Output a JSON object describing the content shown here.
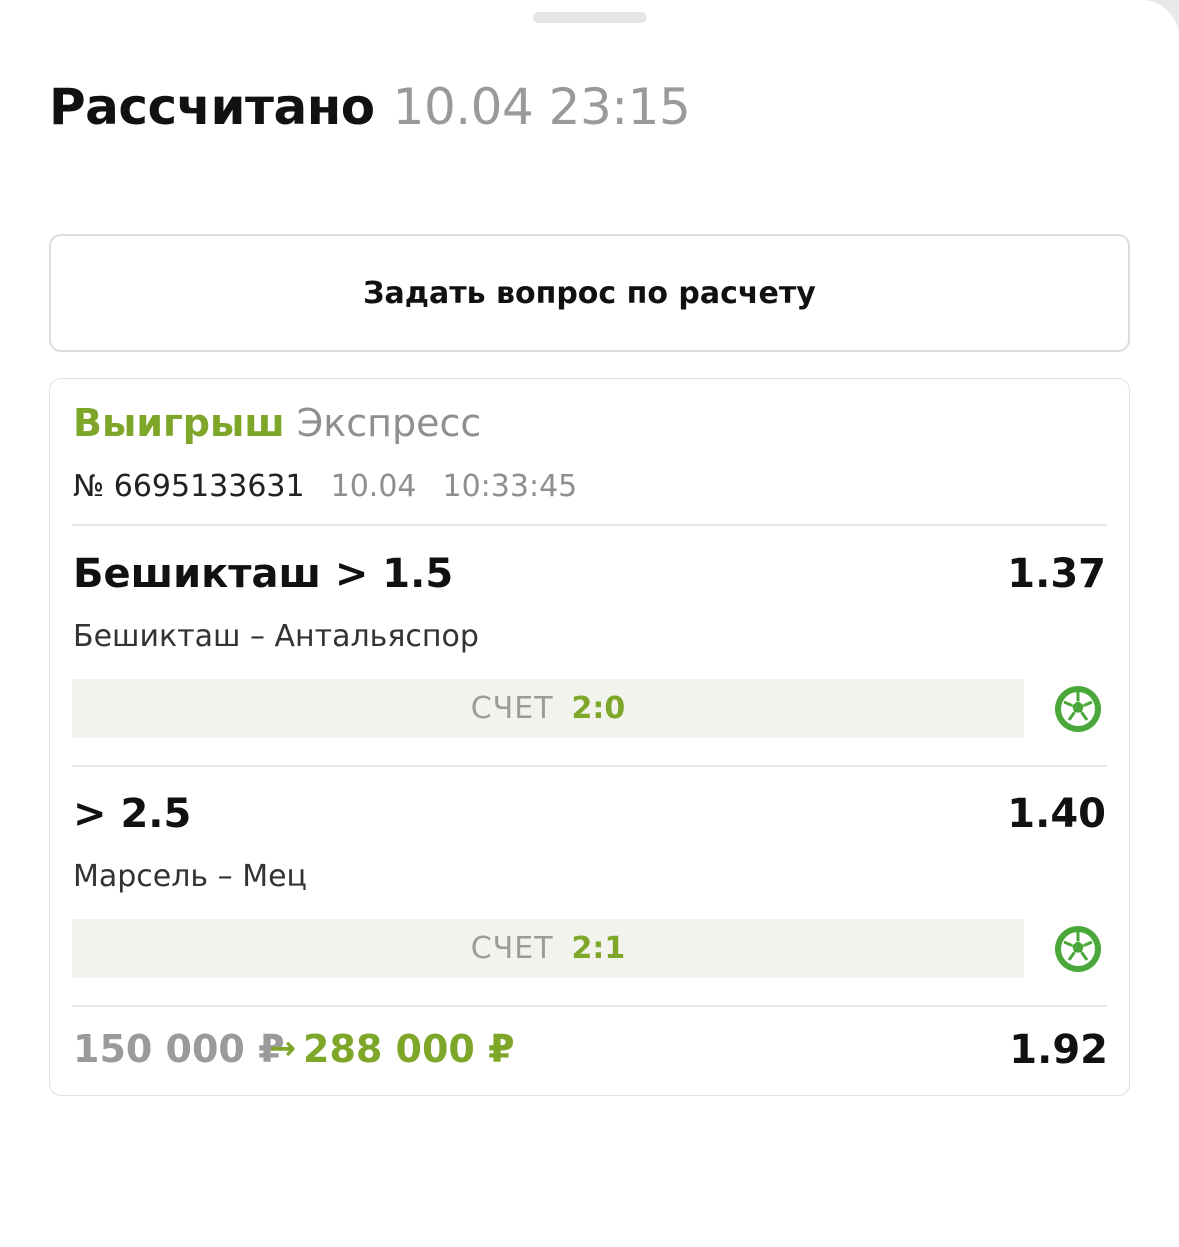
{
  "header": {
    "status": "Рассчитано",
    "datetime": "10.04 23:15"
  },
  "ask_button": {
    "label": "Задать вопрос по расчету"
  },
  "bet": {
    "result": "Выигрыш",
    "type": "Экспресс",
    "number": "№ 6695133631",
    "date": "10.04",
    "time": "10:33:45",
    "events": [
      {
        "pick": "Бешикташ > 1.5",
        "odd": "1.37",
        "match": "Бешикташ – Антальяспор",
        "score_label": "СЧЕТ",
        "score": "2:0",
        "sport_icon": "soccer-ball-icon"
      },
      {
        "pick": "> 2.5",
        "odd": "1.40",
        "match": "Марсель – Мец",
        "score_label": "СЧЕТ",
        "score": "2:1",
        "sport_icon": "soccer-ball-icon"
      }
    ],
    "stake": "150 000 ₽",
    "arrow": "→",
    "payout": "288 000 ₽",
    "total_odd": "1.92"
  },
  "colors": {
    "win_green": "#7ea629",
    "icon_green": "#4aa83a",
    "muted_gray": "#9a9a9a",
    "score_bg": "#f2f3ec"
  }
}
